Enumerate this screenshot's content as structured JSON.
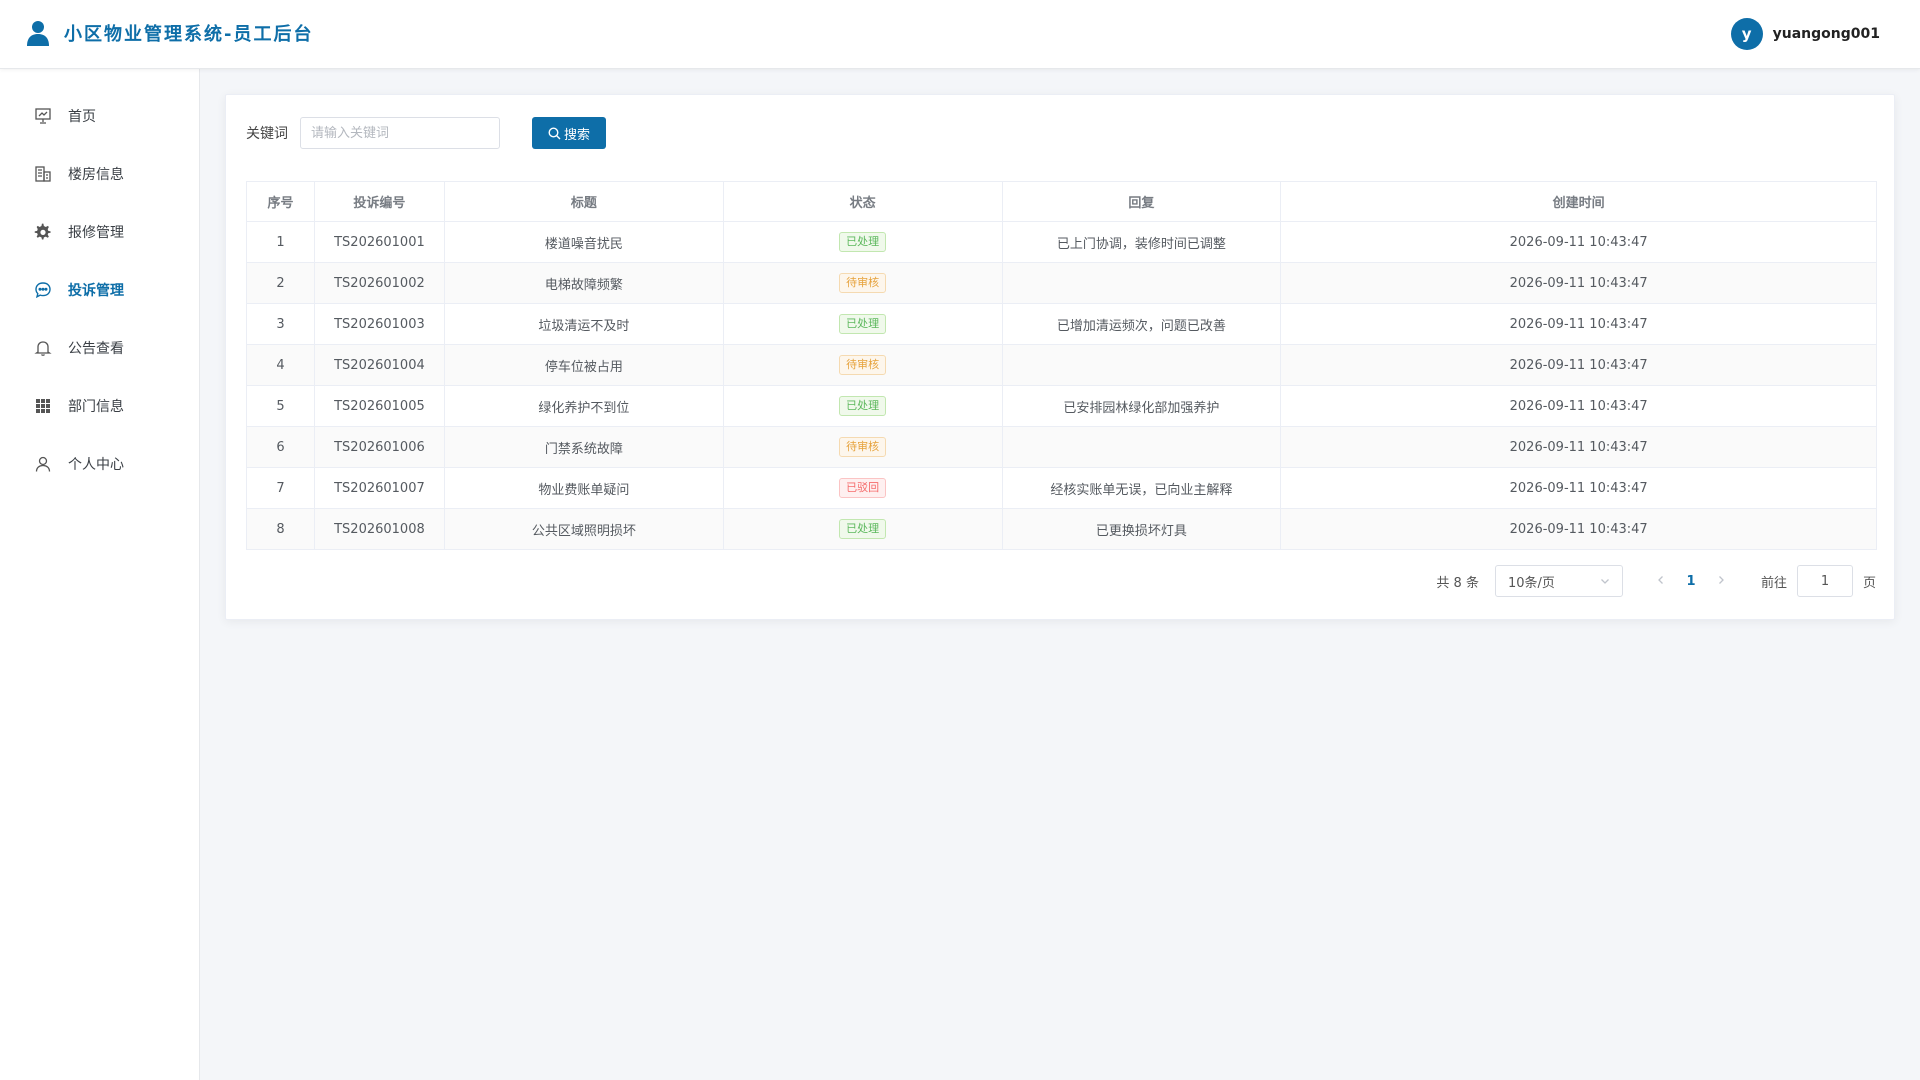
{
  "header": {
    "title": "小区物业管理系统-员工后台",
    "user_initial": "y",
    "username": "yuangong001"
  },
  "sidebar": {
    "items": [
      {
        "label": "首页",
        "icon": "presentation-board-icon",
        "active": false
      },
      {
        "label": "楼房信息",
        "icon": "building-icon",
        "active": false
      },
      {
        "label": "报修管理",
        "icon": "gear-icon",
        "active": false
      },
      {
        "label": "投诉管理",
        "icon": "chat-bubble-icon",
        "active": true
      },
      {
        "label": "公告查看",
        "icon": "bell-icon",
        "active": false
      },
      {
        "label": "部门信息",
        "icon": "grid-icon",
        "active": false
      },
      {
        "label": "个人中心",
        "icon": "user-icon",
        "active": false
      }
    ]
  },
  "search": {
    "label": "关键词",
    "placeholder": "请输入关键词",
    "button_label": "搜索"
  },
  "table": {
    "headers": [
      "序号",
      "投诉编号",
      "标题",
      "状态",
      "回复",
      "创建时间"
    ],
    "rows": [
      {
        "index": "1",
        "code": "TS202601001",
        "title": "楼道噪音扰民",
        "status": "已处理",
        "status_type": "done",
        "reply": "已上门协调，装修时间已调整",
        "created": "2026-09-11 10:43:47"
      },
      {
        "index": "2",
        "code": "TS202601002",
        "title": "电梯故障频繁",
        "status": "待审核",
        "status_type": "pending",
        "reply": "",
        "created": "2026-09-11 10:43:47"
      },
      {
        "index": "3",
        "code": "TS202601003",
        "title": "垃圾清运不及时",
        "status": "已处理",
        "status_type": "done",
        "reply": "已增加清运频次，问题已改善",
        "created": "2026-09-11 10:43:47"
      },
      {
        "index": "4",
        "code": "TS202601004",
        "title": "停车位被占用",
        "status": "待审核",
        "status_type": "pending",
        "reply": "",
        "created": "2026-09-11 10:43:47"
      },
      {
        "index": "5",
        "code": "TS202601005",
        "title": "绿化养护不到位",
        "status": "已处理",
        "status_type": "done",
        "reply": "已安排园林绿化部加强养护",
        "created": "2026-09-11 10:43:47"
      },
      {
        "index": "6",
        "code": "TS202601006",
        "title": "门禁系统故障",
        "status": "待审核",
        "status_type": "pending",
        "reply": "",
        "created": "2026-09-11 10:43:47"
      },
      {
        "index": "7",
        "code": "TS202601007",
        "title": "物业费账单疑问",
        "status": "已驳回",
        "status_type": "rejected",
        "reply": "经核实账单无误，已向业主解释",
        "created": "2026-09-11 10:43:47"
      },
      {
        "index": "8",
        "code": "TS202601008",
        "title": "公共区域照明损坏",
        "status": "已处理",
        "status_type": "done",
        "reply": "已更换损坏灯具",
        "created": "2026-09-11 10:43:47"
      }
    ]
  },
  "pagination": {
    "total_text": "共 8 条",
    "page_size": "10条/页",
    "current_page": "1",
    "goto_label": "前往",
    "goto_value": "1",
    "page_unit": "页"
  },
  "colors": {
    "accent": "#0e6ea8",
    "status_done": "#5cb85c",
    "status_pending": "#e6a23c",
    "status_rejected": "#f56c6c"
  }
}
